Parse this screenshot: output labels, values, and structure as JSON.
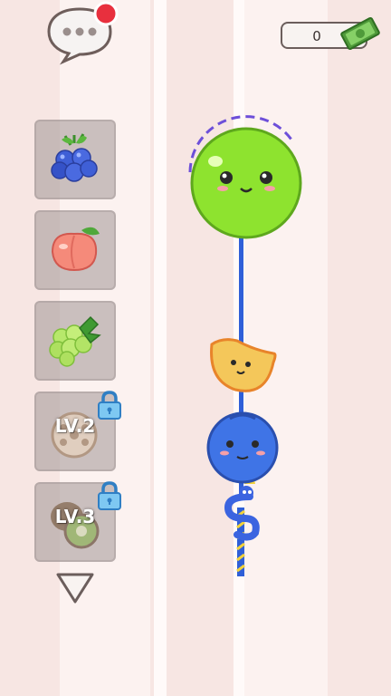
{
  "hud": {
    "money_value": "0",
    "chat_badge": true
  },
  "palette": {
    "background": "#f7e6e3",
    "stripe_light": "#fdf4f2",
    "slot_bg": "#a09696",
    "apple_green": "#8ee32f",
    "blueberry_blue": "#3f74e6",
    "stick_blue": "#2f5fd8",
    "badge_red": "#e8303e"
  },
  "fruit_menu": {
    "items": [
      {
        "icon": "blueberry-icon",
        "locked": false
      },
      {
        "icon": "peach-icon",
        "locked": false
      },
      {
        "icon": "grape-icon",
        "locked": false
      },
      {
        "icon": "lotus-root-icon",
        "locked": true,
        "level_label": "LV.2"
      },
      {
        "icon": "kiwi-icon",
        "locked": true,
        "level_label": "LV.3"
      }
    ],
    "scroll_icon": "chevron-down-icon"
  },
  "skewer": {
    "items": [
      "green-apple-ball",
      "mango-slice",
      "blueberry-ball"
    ],
    "handle_icon": "blue-snake-handle"
  }
}
